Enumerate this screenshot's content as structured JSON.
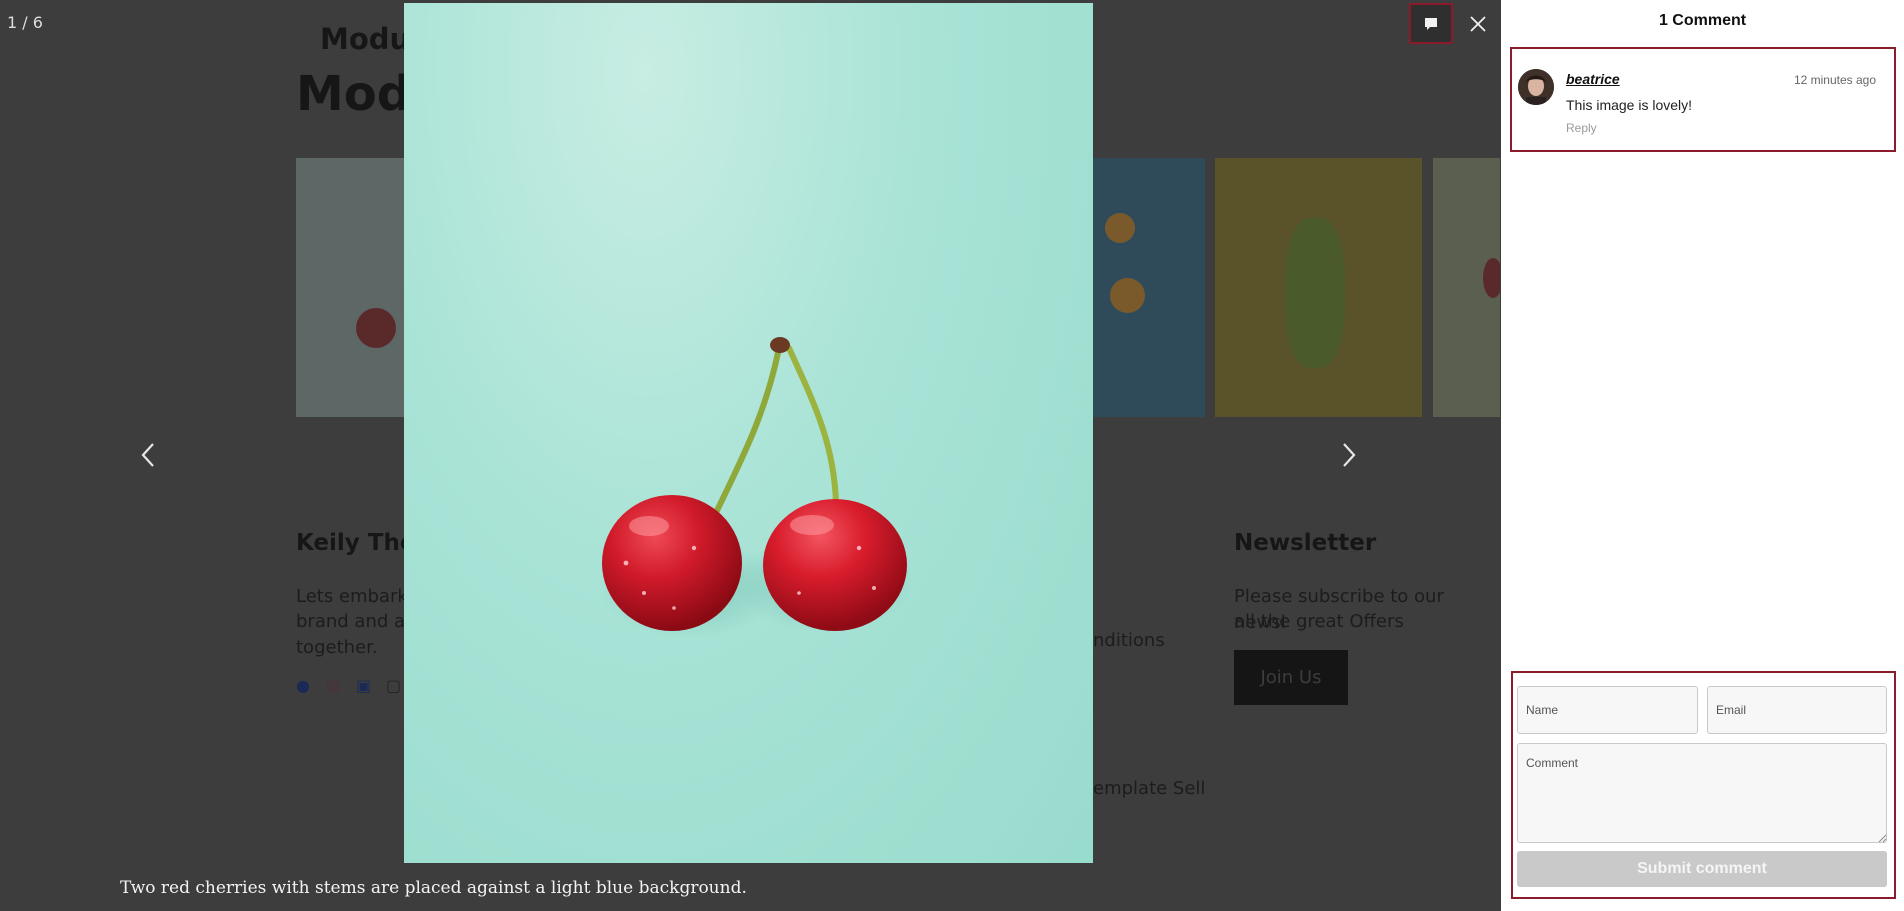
{
  "lightbox": {
    "counter": "1 / 6",
    "caption": "Two red cherries with stems are placed against a light blue background.",
    "icons": {
      "prev": "chevron-left-icon",
      "next": "chevron-right-icon",
      "comments": "comment-icon",
      "close": "close-icon"
    }
  },
  "background_page": {
    "nav_title": "Modu",
    "hero_title": "Mod",
    "footer_col1_heading": "Keily The",
    "footer_col1_text": [
      "Lets embark",
      "brand and a",
      "together."
    ],
    "footer_col2_fragment_1": "nditions",
    "footer_col2_fragment_2": "emplate Sell",
    "newsletter_heading": "Newsletter",
    "newsletter_text": [
      "Please subscribe to our newsl",
      "all the great Offers"
    ],
    "newsletter_button": "Join Us"
  },
  "sidebar": {
    "title": "1 Comment",
    "comments": [
      {
        "author": "beatrice",
        "time": "12 minutes ago",
        "text": "This image is lovely!",
        "reply_label": "Reply"
      }
    ],
    "form": {
      "name_placeholder": "Name",
      "email_placeholder": "Email",
      "comment_placeholder": "Comment",
      "submit_label": "Submit comment"
    }
  },
  "colors": {
    "overlay": "#3d3d3d",
    "highlight_border": "#8b1a2a",
    "photo_background": "#a8e3d6",
    "cherry_red": "#c8102e",
    "submit_disabled": "#c9c9c9"
  }
}
